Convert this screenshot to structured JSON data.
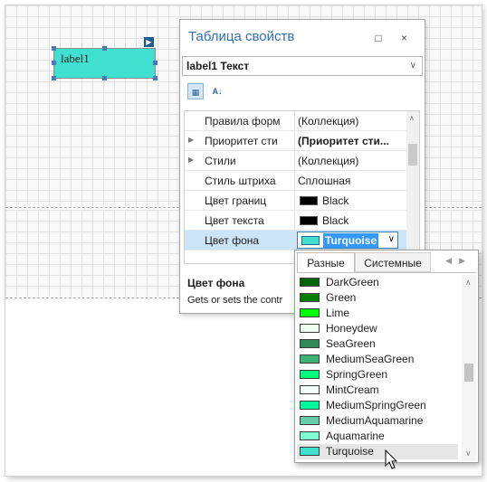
{
  "label_control": {
    "text": "label1"
  },
  "property_panel": {
    "title": "Таблица свойств",
    "title_buttons": "□ ×",
    "object_selector": {
      "value": "label1  Текст"
    },
    "toolbar": {
      "categorized_icon": "categorized-view-icon",
      "alphabetical_icon": "sort-az-icon"
    },
    "rows": [
      {
        "name": "Правила форм",
        "value": "(Коллекция)",
        "expandable": false
      },
      {
        "name": "Приоритет сти",
        "value": "(Приоритет сти...",
        "expandable": true,
        "bold": true
      },
      {
        "name": "Стили",
        "value": "(Коллекция)",
        "expandable": true
      },
      {
        "name": "Стиль штриха",
        "value": "Сплошная",
        "expandable": false
      },
      {
        "name": "Цвет границ",
        "value": "Black",
        "color": "#000000"
      },
      {
        "name": "Цвет текста",
        "value": "Black",
        "color": "#000000"
      },
      {
        "name": "Цвет фона",
        "value": "Turquoise",
        "color": "#40e0d0",
        "selected": true
      }
    ],
    "description": {
      "title": "Цвет фона",
      "text": "Gets or sets the contr"
    }
  },
  "color_dropdown": {
    "tabs": [
      "Разные",
      "Системные"
    ],
    "active_tab": "Разные",
    "colors": [
      {
        "name": "DarkGreen",
        "hex": "#006400"
      },
      {
        "name": "Green",
        "hex": "#008000"
      },
      {
        "name": "Lime",
        "hex": "#00ff00"
      },
      {
        "name": "Honeydew",
        "hex": "#f0fff0"
      },
      {
        "name": "SeaGreen",
        "hex": "#2e8b57"
      },
      {
        "name": "MediumSeaGreen",
        "hex": "#3cb371"
      },
      {
        "name": "SpringGreen",
        "hex": "#00ff7f"
      },
      {
        "name": "MintCream",
        "hex": "#f5fffa"
      },
      {
        "name": "MediumSpringGreen",
        "hex": "#00fa9a"
      },
      {
        "name": "MediumAquamarine",
        "hex": "#66cdaa"
      },
      {
        "name": "Aquamarine",
        "hex": "#7fffd4"
      },
      {
        "name": "Turquoise",
        "hex": "#40e0d0",
        "selected": true
      }
    ]
  }
}
